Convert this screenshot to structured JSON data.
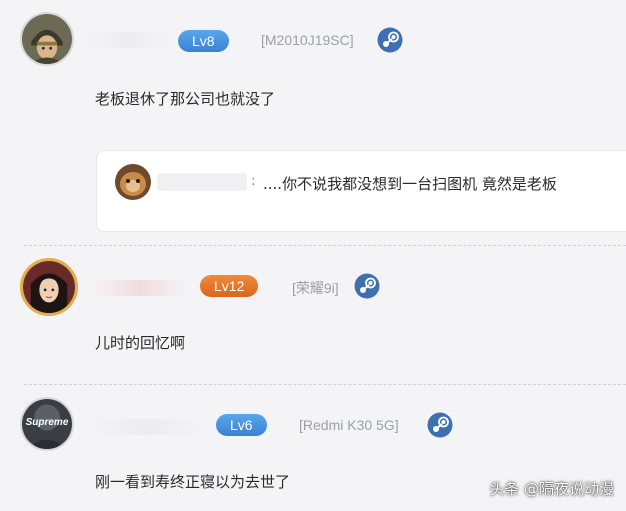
{
  "comments": [
    {
      "avatar": "warrior-helmet-avatar",
      "level": "Lv8",
      "device": "[M2010J19SC]",
      "platform_icon": "steam-icon",
      "text": "老板退休了那公司也就没了",
      "reply": {
        "avatar": "orange-cat-avatar",
        "separator": ":",
        "text": "....你不说我都没想到一台扫图机 竟然是老板"
      }
    },
    {
      "avatar": "girl-portrait-avatar",
      "level": "Lv12",
      "device": "[荣耀9i]",
      "platform_icon": "steam-icon",
      "text": "儿时的回忆啊"
    },
    {
      "avatar": "supreme-avatar",
      "avatar_text": "Supreme",
      "level": "Lv6",
      "device": "[Redmi K30 5G]",
      "platform_icon": "steam-icon",
      "text": "刚一看到寿终正寝以为去世了"
    }
  ],
  "watermark": "头条 @隔夜说动漫",
  "colors": {
    "badge_blue": "#3a82d2",
    "badge_orange": "#d8661e",
    "device_gray": "#9aa0a8",
    "steam_blue": "#3e6fb0"
  }
}
